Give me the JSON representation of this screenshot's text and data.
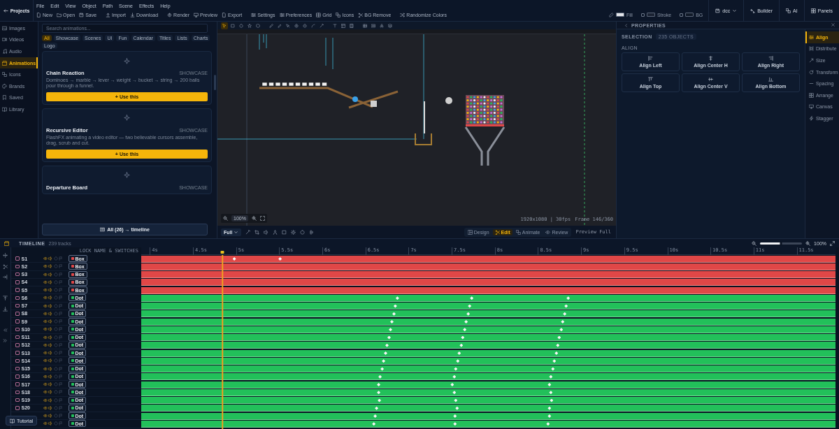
{
  "top_bar": {
    "back_button": "Projects",
    "menus": [
      "File",
      "Edit",
      "View",
      "Object",
      "Path",
      "Scene",
      "Effects",
      "Help"
    ],
    "toolbar": [
      {
        "kind": "new",
        "label": "New"
      },
      {
        "kind": "open",
        "label": "Open"
      },
      {
        "kind": "save",
        "label": "Save"
      },
      {
        "kind": "import",
        "label": "Import"
      },
      {
        "kind": "download",
        "label": "Download"
      },
      {
        "kind": "render",
        "label": "Render"
      },
      {
        "kind": "preview",
        "label": "Preview"
      },
      {
        "kind": "export",
        "label": "Export"
      },
      {
        "kind": "settings",
        "label": "Settings"
      },
      {
        "kind": "preferences",
        "label": "Preferences"
      },
      {
        "kind": "grid",
        "label": "Grid"
      },
      {
        "kind": "icons",
        "label": "Icons"
      },
      {
        "kind": "bg_remove",
        "label": "BG Remove"
      },
      {
        "kind": "randomize",
        "label": "Randomize Colors"
      }
    ],
    "colors": [
      {
        "kind": "fill",
        "label": "Fill",
        "color": "#e4e6ea"
      },
      {
        "kind": "stroke",
        "label": "Stroke",
        "checked": false,
        "color": "#1a2232"
      },
      {
        "kind": "bg",
        "label": "BG",
        "checked": false,
        "color": "#111a28"
      }
    ],
    "project": "dcc",
    "right_buttons": [
      {
        "kind": "builder",
        "label": "Builder"
      },
      {
        "kind": "ai",
        "label": "AI"
      },
      {
        "kind": "panels",
        "label": "Panels"
      }
    ]
  },
  "sidebar": {
    "items": [
      {
        "kind": "images",
        "label": "Images",
        "selected": false
      },
      {
        "kind": "videos",
        "label": "Videos",
        "selected": false
      },
      {
        "kind": "audio",
        "label": "Audio",
        "selected": false
      },
      {
        "kind": "animations",
        "label": "Animations",
        "selected": true
      },
      {
        "kind": "icons",
        "label": "Icons",
        "selected": false
      },
      {
        "kind": "brands",
        "label": "Brands",
        "selected": false
      },
      {
        "kind": "saved",
        "label": "Saved",
        "selected": false
      },
      {
        "kind": "library",
        "label": "Library",
        "selected": false
      }
    ]
  },
  "library": {
    "search": {
      "placeholder": "Search animations..."
    },
    "filters": [
      {
        "label": "All",
        "selected": true
      },
      {
        "label": "Showcase",
        "selected": false
      },
      {
        "label": "Scenes",
        "selected": false
      },
      {
        "label": "UI",
        "selected": false
      },
      {
        "label": "Fun",
        "selected": false
      },
      {
        "label": "Calendar",
        "selected": false
      },
      {
        "label": "Titles",
        "selected": false
      },
      {
        "label": "Lists",
        "selected": false
      },
      {
        "label": "Charts",
        "selected": false
      },
      {
        "label": "Logo",
        "selected": false
      }
    ],
    "cards": [
      {
        "title": "Chain Reaction",
        "category": "SHOWCASE",
        "description": "Dominoes → marble → lever → weight → bucket → string → 200 balls pour through a funnel.",
        "button": "+ Use this"
      },
      {
        "title": "Recursive Editor",
        "category": "SHOWCASE",
        "description": "FlashFX animating a video editor — two believable cursors assemble, drag, scrub and cut.",
        "button": "+ Use this"
      },
      {
        "title": "Departure Board",
        "category": "SHOWCASE"
      }
    ],
    "all_button": "All (26) → timeline"
  },
  "canvas": {
    "tools": [
      {
        "kind": "select",
        "selected": true
      },
      {
        "kind": "rect",
        "selected": false
      },
      {
        "kind": "ellipse",
        "selected": false
      },
      {
        "kind": "star",
        "selected": false
      },
      {
        "kind": "polygon",
        "selected": false
      },
      {
        "kind": "pen",
        "selected": false
      },
      {
        "kind": "pencil",
        "selected": false
      },
      {
        "kind": "node",
        "selected": false
      },
      {
        "kind": "add",
        "selected": false
      },
      {
        "kind": "subtract",
        "selected": false
      },
      {
        "kind": "arc",
        "selected": false
      },
      {
        "kind": "magic",
        "selected": false
      },
      {
        "kind": "text",
        "selected": false
      },
      {
        "kind": "frame",
        "selected": false
      },
      {
        "kind": "film",
        "selected": false
      },
      {
        "kind": "table",
        "selected": false
      },
      {
        "kind": "list",
        "selected": false
      },
      {
        "kind": "cluster",
        "selected": false
      },
      {
        "kind": "layers",
        "selected": false
      }
    ],
    "zoom": "100%",
    "size": "1920x1080 | 30fps",
    "frame": "Frame 146/360",
    "fit": "Full",
    "modes": [
      {
        "kind": "design",
        "label": "Design",
        "selected": false
      },
      {
        "kind": "edit",
        "label": "Edit",
        "selected": true
      },
      {
        "kind": "animate",
        "label": "Animate",
        "selected": false
      },
      {
        "kind": "review",
        "label": "Review",
        "selected": false
      }
    ],
    "preview": "Preview Full"
  },
  "properties": {
    "title": "PROPERTIES",
    "selection_label": "SELECTION",
    "selection_count": "235 OBJECTS",
    "section": "ALIGN",
    "align_buttons": [
      {
        "kind": "left",
        "label": "Align Left"
      },
      {
        "kind": "center_h",
        "label": "Align Center H"
      },
      {
        "kind": "right",
        "label": "Align Right"
      },
      {
        "kind": "top",
        "label": "Align Top"
      },
      {
        "kind": "center_v",
        "label": "Align Center V"
      },
      {
        "kind": "bottom",
        "label": "Align Bottom"
      }
    ],
    "tabs": [
      {
        "kind": "align",
        "label": "Align",
        "selected": true
      },
      {
        "kind": "distribute",
        "label": "Distribute",
        "selected": false
      },
      {
        "kind": "size",
        "label": "Size",
        "selected": false
      },
      {
        "kind": "transform",
        "label": "Transform",
        "selected": false
      },
      {
        "kind": "spacing",
        "label": "Spacing",
        "selected": false
      },
      {
        "kind": "arrange",
        "label": "Arrange",
        "selected": false
      },
      {
        "kind": "canvas",
        "label": "Canvas",
        "selected": false
      },
      {
        "kind": "stagger",
        "label": "Stagger",
        "selected": false
      }
    ]
  },
  "timeline": {
    "title": "TIMELINE",
    "track_count": "239 tracks",
    "zoom": {
      "level": 0.5,
      "reading": "100%"
    },
    "column_header": "LOCK NAME & SWITCHES",
    "playhead": {
      "level": 0.117
    },
    "ticks": [
      "4s",
      "4.5s",
      "5s",
      "5.5s",
      "6s",
      "6.5s",
      "7s",
      "7.5s",
      "8s",
      "8.5s",
      "9s",
      "9.5s",
      "10s",
      "10.5s",
      "11s",
      "11.5s"
    ],
    "tracks": [
      {
        "name": "S1",
        "checked": false,
        "visible": true,
        "audio": true,
        "solo": false,
        "flag": false,
        "tag": "Box",
        "color": "#e04747",
        "keyframes": [
          {
            "level": 0.134
          },
          {
            "level": 0.2
          }
        ]
      },
      {
        "name": "S2",
        "checked": false,
        "visible": true,
        "audio": true,
        "solo": false,
        "flag": false,
        "tag": "Box",
        "color": "#e04747"
      },
      {
        "name": "S3",
        "checked": false,
        "visible": true,
        "audio": true,
        "solo": false,
        "flag": false,
        "tag": "Box",
        "color": "#e04747"
      },
      {
        "name": "S4",
        "checked": false,
        "visible": true,
        "audio": true,
        "solo": false,
        "flag": false,
        "tag": "Box",
        "color": "#e04747"
      },
      {
        "name": "S5",
        "checked": false,
        "visible": true,
        "audio": true,
        "solo": false,
        "flag": false,
        "tag": "Box",
        "color": "#e04747"
      },
      {
        "name": "S6",
        "checked": false,
        "visible": true,
        "audio": true,
        "solo": false,
        "flag": false,
        "tag": "Dot",
        "color": "#22c05a",
        "keyframes": [
          {
            "level": 0.369
          },
          {
            "level": 0.476
          },
          {
            "level": 0.615
          }
        ]
      },
      {
        "name": "S7",
        "checked": false,
        "visible": true,
        "audio": true,
        "solo": false,
        "flag": false,
        "tag": "Dot",
        "color": "#22c05a",
        "keyframes": [
          {
            "level": 0.366
          },
          {
            "level": 0.473
          },
          {
            "level": 0.612
          }
        ]
      },
      {
        "name": "S8",
        "checked": false,
        "visible": true,
        "audio": true,
        "solo": false,
        "flag": false,
        "tag": "Dot",
        "color": "#22c05a",
        "keyframes": [
          {
            "level": 0.364
          },
          {
            "level": 0.471
          },
          {
            "level": 0.61
          }
        ]
      },
      {
        "name": "S9",
        "checked": false,
        "visible": true,
        "audio": true,
        "solo": false,
        "flag": false,
        "tag": "Dot",
        "color": "#22c05a",
        "keyframes": [
          {
            "level": 0.361
          },
          {
            "level": 0.468
          },
          {
            "level": 0.607
          }
        ]
      },
      {
        "name": "S10",
        "checked": false,
        "visible": true,
        "audio": true,
        "solo": false,
        "flag": false,
        "tag": "Dot",
        "color": "#22c05a",
        "keyframes": [
          {
            "level": 0.359
          },
          {
            "level": 0.466
          },
          {
            "level": 0.605
          }
        ]
      },
      {
        "name": "S11",
        "checked": false,
        "visible": true,
        "audio": true,
        "solo": false,
        "flag": false,
        "tag": "Dot",
        "color": "#22c05a",
        "keyframes": [
          {
            "level": 0.357
          },
          {
            "level": 0.463
          },
          {
            "level": 0.602
          }
        ]
      },
      {
        "name": "S12",
        "checked": false,
        "visible": true,
        "audio": true,
        "solo": false,
        "flag": false,
        "tag": "Dot",
        "color": "#22c05a",
        "keyframes": [
          {
            "level": 0.354
          },
          {
            "level": 0.461
          },
          {
            "level": 0.6
          }
        ]
      },
      {
        "name": "S13",
        "checked": false,
        "visible": true,
        "audio": true,
        "solo": false,
        "flag": false,
        "tag": "Dot",
        "color": "#22c05a",
        "keyframes": [
          {
            "level": 0.352
          },
          {
            "level": 0.458
          },
          {
            "level": 0.598
          }
        ]
      },
      {
        "name": "S14",
        "checked": false,
        "visible": true,
        "audio": true,
        "solo": false,
        "flag": false,
        "tag": "Dot",
        "color": "#22c05a",
        "keyframes": [
          {
            "level": 0.349
          },
          {
            "level": 0.456
          },
          {
            "level": 0.595
          }
        ]
      },
      {
        "name": "S15",
        "checked": false,
        "visible": true,
        "audio": true,
        "solo": false,
        "flag": false,
        "tag": "Dot",
        "color": "#22c05a",
        "keyframes": [
          {
            "level": 0.347
          },
          {
            "level": 0.453
          },
          {
            "level": 0.593
          }
        ]
      },
      {
        "name": "S16",
        "checked": false,
        "visible": true,
        "audio": true,
        "solo": false,
        "flag": false,
        "tag": "Dot",
        "color": "#22c05a",
        "keyframes": [
          {
            "level": 0.344
          },
          {
            "level": 0.451
          },
          {
            "level": 0.59
          }
        ]
      },
      {
        "name": "S17",
        "checked": false,
        "visible": true,
        "audio": true,
        "solo": false,
        "flag": false,
        "tag": "Dot",
        "color": "#22c05a",
        "keyframes": [
          {
            "level": 0.342
          },
          {
            "level": 0.448
          },
          {
            "level": 0.588
          }
        ]
      },
      {
        "name": "S18",
        "checked": false,
        "visible": true,
        "audio": true,
        "solo": false,
        "flag": false,
        "tag": "Dot",
        "color": "#22c05a",
        "keyframes": [
          {
            "level": 0.342
          },
          {
            "level": 0.451
          },
          {
            "level": 0.59
          }
        ]
      },
      {
        "name": "S19",
        "checked": false,
        "visible": true,
        "audio": true,
        "solo": false,
        "flag": false,
        "tag": "Dot",
        "color": "#22c05a",
        "keyframes": [
          {
            "level": 0.343
          },
          {
            "level": 0.453
          },
          {
            "level": 0.591
          }
        ]
      },
      {
        "name": "S20",
        "checked": false,
        "visible": true,
        "audio": true,
        "solo": false,
        "flag": false,
        "tag": "Dot",
        "color": "#22c05a",
        "keyframes": [
          {
            "level": 0.339
          },
          {
            "level": 0.455
          },
          {
            "level": 0.588
          }
        ]
      },
      {
        "visible": true,
        "audio": true,
        "solo": false,
        "flag": false,
        "tag": "Dot",
        "color": "#22c05a",
        "keyframes": [
          {
            "level": 0.337
          },
          {
            "level": 0.452
          },
          {
            "level": 0.588
          }
        ]
      },
      {
        "visible": true,
        "audio": true,
        "solo": false,
        "flag": false,
        "tag": "Dot",
        "color": "#22c05a",
        "keyframes": [
          {
            "level": 0.335
          },
          {
            "level": 0.452
          },
          {
            "level": 0.586
          }
        ]
      }
    ],
    "tutorial_button": "Tutorial"
  }
}
